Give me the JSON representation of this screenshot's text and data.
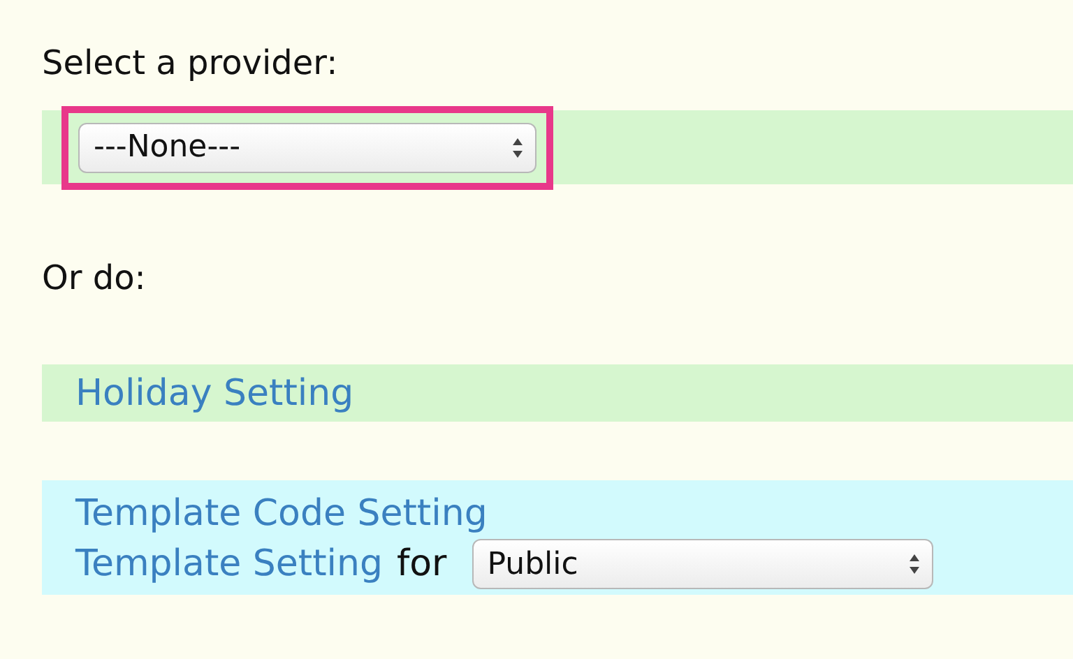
{
  "prompt": "Select a provider:",
  "provider_select": {
    "value": "---None---",
    "highlighted": true
  },
  "alt_prompt": "Or do:",
  "holiday_link": "Holiday Setting",
  "template_section": {
    "code_link": "Template Code Setting",
    "setting_link": "Template Setting",
    "for_text": "for",
    "scope_select": {
      "value": "Public"
    }
  }
}
